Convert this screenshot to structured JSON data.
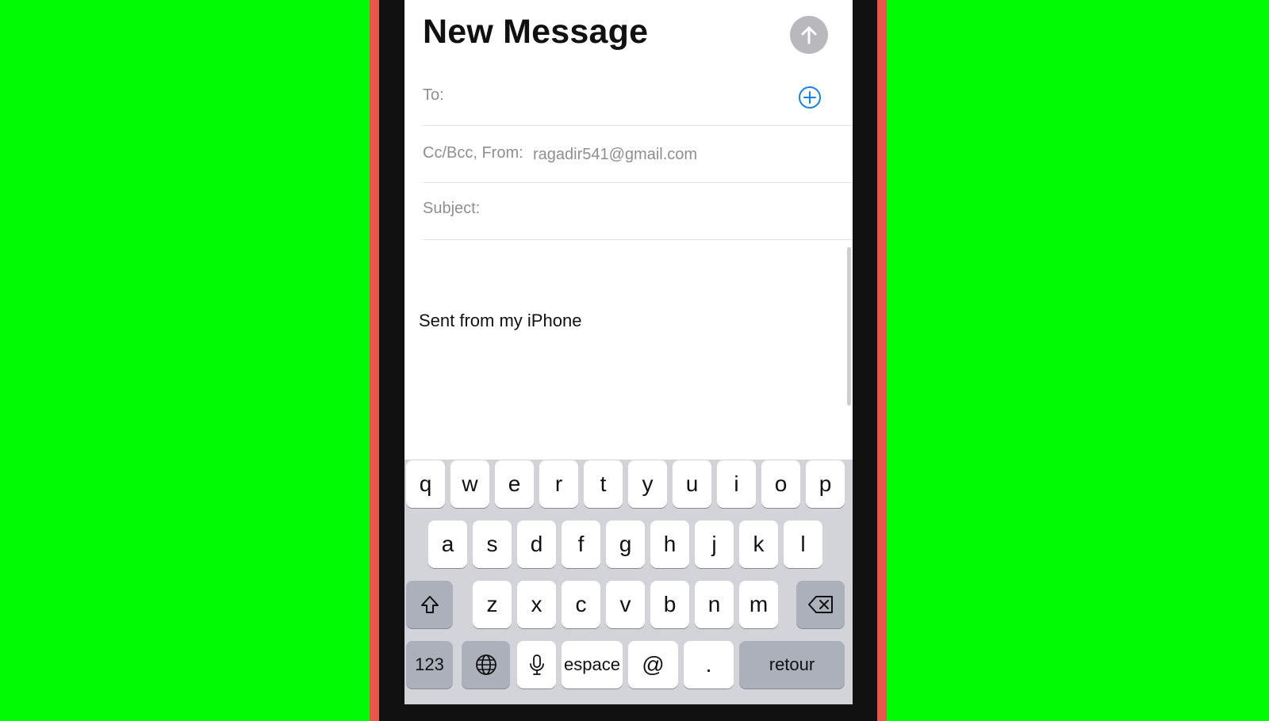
{
  "compose": {
    "title": "New Message",
    "to_label": "To:",
    "to_value": "",
    "ccbcc_label": "Cc/Bcc, From:",
    "from_value": "ragadir541@gmail.com",
    "subject_label": "Subject:",
    "subject_value": "",
    "body_signature": "Sent from my iPhone"
  },
  "icons": {
    "send": "arrow-up-icon",
    "add_contact": "plus-circle-icon",
    "shift": "shift-icon",
    "backspace": "backspace-icon",
    "globe": "globe-icon",
    "mic": "microphone-icon"
  },
  "colors": {
    "background_green": "#00fb04",
    "phone_case": "#e8554b",
    "accent_blue": "#1a7fe0",
    "send_button_disabled": "#b9b9bd",
    "keyboard_bg": "#d3d4d9",
    "key_dark": "#abb0ba"
  },
  "keyboard": {
    "row1": [
      "q",
      "w",
      "e",
      "r",
      "t",
      "y",
      "u",
      "i",
      "o",
      "p"
    ],
    "row2": [
      "a",
      "s",
      "d",
      "f",
      "g",
      "h",
      "j",
      "k",
      "l"
    ],
    "row3": [
      "z",
      "x",
      "c",
      "v",
      "b",
      "n",
      "m"
    ],
    "numbers_label": "123",
    "space_label": "espace",
    "at_label": "@",
    "period_label": ".",
    "return_label": "retour"
  }
}
